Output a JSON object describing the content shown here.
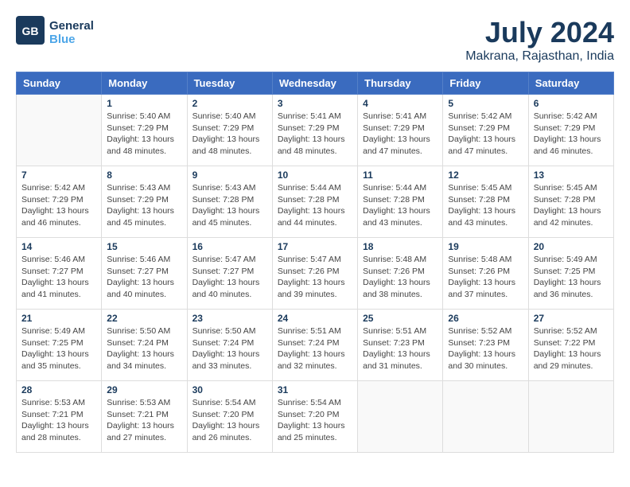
{
  "header": {
    "logo_line1": "General",
    "logo_line2": "Blue",
    "title": "July 2024",
    "subtitle": "Makrana, Rajasthan, India"
  },
  "days_of_week": [
    "Sunday",
    "Monday",
    "Tuesday",
    "Wednesday",
    "Thursday",
    "Friday",
    "Saturday"
  ],
  "weeks": [
    [
      {
        "day": "",
        "detail": ""
      },
      {
        "day": "1",
        "detail": "Sunrise: 5:40 AM\nSunset: 7:29 PM\nDaylight: 13 hours\nand 48 minutes."
      },
      {
        "day": "2",
        "detail": "Sunrise: 5:40 AM\nSunset: 7:29 PM\nDaylight: 13 hours\nand 48 minutes."
      },
      {
        "day": "3",
        "detail": "Sunrise: 5:41 AM\nSunset: 7:29 PM\nDaylight: 13 hours\nand 48 minutes."
      },
      {
        "day": "4",
        "detail": "Sunrise: 5:41 AM\nSunset: 7:29 PM\nDaylight: 13 hours\nand 47 minutes."
      },
      {
        "day": "5",
        "detail": "Sunrise: 5:42 AM\nSunset: 7:29 PM\nDaylight: 13 hours\nand 47 minutes."
      },
      {
        "day": "6",
        "detail": "Sunrise: 5:42 AM\nSunset: 7:29 PM\nDaylight: 13 hours\nand 46 minutes."
      }
    ],
    [
      {
        "day": "7",
        "detail": "Sunrise: 5:42 AM\nSunset: 7:29 PM\nDaylight: 13 hours\nand 46 minutes."
      },
      {
        "day": "8",
        "detail": "Sunrise: 5:43 AM\nSunset: 7:29 PM\nDaylight: 13 hours\nand 45 minutes."
      },
      {
        "day": "9",
        "detail": "Sunrise: 5:43 AM\nSunset: 7:28 PM\nDaylight: 13 hours\nand 45 minutes."
      },
      {
        "day": "10",
        "detail": "Sunrise: 5:44 AM\nSunset: 7:28 PM\nDaylight: 13 hours\nand 44 minutes."
      },
      {
        "day": "11",
        "detail": "Sunrise: 5:44 AM\nSunset: 7:28 PM\nDaylight: 13 hours\nand 43 minutes."
      },
      {
        "day": "12",
        "detail": "Sunrise: 5:45 AM\nSunset: 7:28 PM\nDaylight: 13 hours\nand 43 minutes."
      },
      {
        "day": "13",
        "detail": "Sunrise: 5:45 AM\nSunset: 7:28 PM\nDaylight: 13 hours\nand 42 minutes."
      }
    ],
    [
      {
        "day": "14",
        "detail": "Sunrise: 5:46 AM\nSunset: 7:27 PM\nDaylight: 13 hours\nand 41 minutes."
      },
      {
        "day": "15",
        "detail": "Sunrise: 5:46 AM\nSunset: 7:27 PM\nDaylight: 13 hours\nand 40 minutes."
      },
      {
        "day": "16",
        "detail": "Sunrise: 5:47 AM\nSunset: 7:27 PM\nDaylight: 13 hours\nand 40 minutes."
      },
      {
        "day": "17",
        "detail": "Sunrise: 5:47 AM\nSunset: 7:26 PM\nDaylight: 13 hours\nand 39 minutes."
      },
      {
        "day": "18",
        "detail": "Sunrise: 5:48 AM\nSunset: 7:26 PM\nDaylight: 13 hours\nand 38 minutes."
      },
      {
        "day": "19",
        "detail": "Sunrise: 5:48 AM\nSunset: 7:26 PM\nDaylight: 13 hours\nand 37 minutes."
      },
      {
        "day": "20",
        "detail": "Sunrise: 5:49 AM\nSunset: 7:25 PM\nDaylight: 13 hours\nand 36 minutes."
      }
    ],
    [
      {
        "day": "21",
        "detail": "Sunrise: 5:49 AM\nSunset: 7:25 PM\nDaylight: 13 hours\nand 35 minutes."
      },
      {
        "day": "22",
        "detail": "Sunrise: 5:50 AM\nSunset: 7:24 PM\nDaylight: 13 hours\nand 34 minutes."
      },
      {
        "day": "23",
        "detail": "Sunrise: 5:50 AM\nSunset: 7:24 PM\nDaylight: 13 hours\nand 33 minutes."
      },
      {
        "day": "24",
        "detail": "Sunrise: 5:51 AM\nSunset: 7:24 PM\nDaylight: 13 hours\nand 32 minutes."
      },
      {
        "day": "25",
        "detail": "Sunrise: 5:51 AM\nSunset: 7:23 PM\nDaylight: 13 hours\nand 31 minutes."
      },
      {
        "day": "26",
        "detail": "Sunrise: 5:52 AM\nSunset: 7:23 PM\nDaylight: 13 hours\nand 30 minutes."
      },
      {
        "day": "27",
        "detail": "Sunrise: 5:52 AM\nSunset: 7:22 PM\nDaylight: 13 hours\nand 29 minutes."
      }
    ],
    [
      {
        "day": "28",
        "detail": "Sunrise: 5:53 AM\nSunset: 7:21 PM\nDaylight: 13 hours\nand 28 minutes."
      },
      {
        "day": "29",
        "detail": "Sunrise: 5:53 AM\nSunset: 7:21 PM\nDaylight: 13 hours\nand 27 minutes."
      },
      {
        "day": "30",
        "detail": "Sunrise: 5:54 AM\nSunset: 7:20 PM\nDaylight: 13 hours\nand 26 minutes."
      },
      {
        "day": "31",
        "detail": "Sunrise: 5:54 AM\nSunset: 7:20 PM\nDaylight: 13 hours\nand 25 minutes."
      },
      {
        "day": "",
        "detail": ""
      },
      {
        "day": "",
        "detail": ""
      },
      {
        "day": "",
        "detail": ""
      }
    ]
  ]
}
